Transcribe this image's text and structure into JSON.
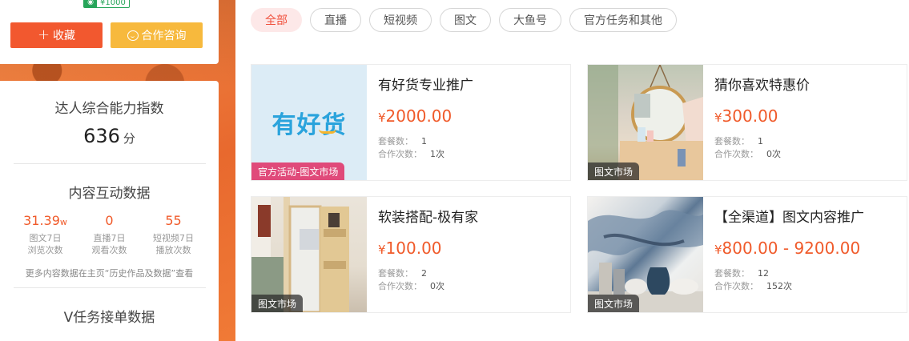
{
  "profile": {
    "price_tag": "¥1000",
    "collect_button": "收藏",
    "coop_button": "合作咨询"
  },
  "stats": {
    "ability_title": "达人综合能力指数",
    "ability_score": "636",
    "ability_unit": "分",
    "interaction_title": "内容互动数据",
    "metrics": [
      {
        "value": "31.39",
        "unit": "w",
        "label1": "图文7日",
        "label2": "浏览次数"
      },
      {
        "value": "0",
        "unit": "",
        "label1": "直播7日",
        "label2": "观看次数"
      },
      {
        "value": "55",
        "unit": "",
        "label1": "短视频7日",
        "label2": "播放次数"
      }
    ],
    "more_note": "更多内容数据在主页“历史作品及数据”查看",
    "vtask_title": "V任务接单数据"
  },
  "filters": [
    {
      "label": "全部",
      "active": true
    },
    {
      "label": "直播",
      "active": false
    },
    {
      "label": "短视频",
      "active": false
    },
    {
      "label": "图文",
      "active": false
    },
    {
      "label": "大鱼号",
      "active": false
    },
    {
      "label": "官方任务和其他",
      "active": false
    }
  ],
  "cards": [
    {
      "title": "有好货专业推广",
      "price": "2000.00",
      "packages_label": "套餐数：",
      "packages": "1",
      "coop_label": "合作次数：",
      "coop": "1次",
      "tag": "官方活动-图文市场",
      "logo_text": "有好货"
    },
    {
      "title": "猜你喜欢特惠价",
      "price": "300.00",
      "packages_label": "套餐数：",
      "packages": "1",
      "coop_label": "合作次数：",
      "coop": "0次",
      "tag": "图文市场"
    },
    {
      "title": "软装搭配-极有家",
      "price": "100.00",
      "packages_label": "套餐数：",
      "packages": "2",
      "coop_label": "合作次数：",
      "coop": "0次",
      "tag": "图文市场"
    },
    {
      "title": "【全渠道】图文内容推广",
      "price": "800.00 - 9200.00",
      "packages_label": "套餐数：",
      "packages": "12",
      "coop_label": "合作次数：",
      "coop": "152次",
      "tag": "图文市场"
    }
  ],
  "currency": "¥",
  "colors": {
    "accent": "#f05a2a",
    "collect": "#f2582f",
    "coop": "#f7b93d",
    "active_chip_bg": "#fde8e8"
  }
}
